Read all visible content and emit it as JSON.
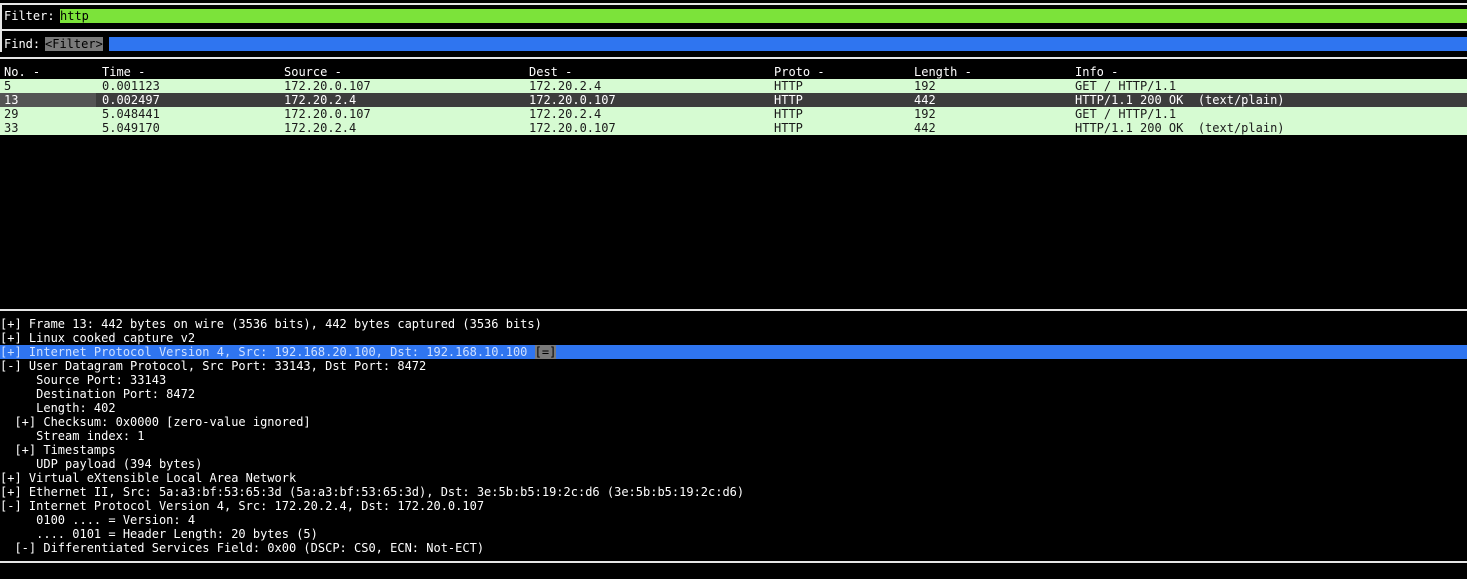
{
  "filter": {
    "label": "Filter:",
    "value": "http"
  },
  "find": {
    "label": "Find:",
    "placeholder": "<Filter>"
  },
  "packet_list": {
    "headers": [
      "No. -",
      "Time -",
      "Source -",
      "Dest -",
      "Proto -",
      "Length -",
      "Info -"
    ],
    "rows": [
      {
        "no": "5",
        "time": "0.001123",
        "src": "172.20.0.107",
        "dst": "172.20.2.4",
        "proto": "HTTP",
        "len": "192",
        "info": "GET / HTTP/1.1",
        "selected": false
      },
      {
        "no": "13",
        "time": "0.002497",
        "src": "172.20.2.4",
        "dst": "172.20.0.107",
        "proto": "HTTP",
        "len": "442",
        "info": "HTTP/1.1 200 OK  (text/plain)",
        "selected": true
      },
      {
        "no": "29",
        "time": "5.048441",
        "src": "172.20.0.107",
        "dst": "172.20.2.4",
        "proto": "HTTP",
        "len": "192",
        "info": "GET / HTTP/1.1",
        "selected": false
      },
      {
        "no": "33",
        "time": "5.049170",
        "src": "172.20.2.4",
        "dst": "172.20.0.107",
        "proto": "HTTP",
        "len": "442",
        "info": "HTTP/1.1 200 OK  (text/plain)",
        "selected": false
      }
    ]
  },
  "details": [
    {
      "text": "[+] Frame 13: 442 bytes on wire (3536 bits), 442 bytes captured (3536 bits)",
      "highlight": false
    },
    {
      "text": "[+] Linux cooked capture v2",
      "highlight": false
    },
    {
      "text": "[+] Internet Protocol Version 4, Src: 192.168.20.100, Dst: 192.168.10.100 ",
      "badge": "[=]",
      "highlight": true
    },
    {
      "text": "[-] User Datagram Protocol, Src Port: 33143, Dst Port: 8472",
      "highlight": false
    },
    {
      "text": "     Source Port: 33143",
      "highlight": false
    },
    {
      "text": "     Destination Port: 8472",
      "highlight": false
    },
    {
      "text": "     Length: 402",
      "highlight": false
    },
    {
      "text": "  [+] Checksum: 0x0000 [zero-value ignored]",
      "highlight": false
    },
    {
      "text": "     Stream index: 1",
      "highlight": false
    },
    {
      "text": "  [+] Timestamps",
      "highlight": false
    },
    {
      "text": "     UDP payload (394 bytes)",
      "highlight": false
    },
    {
      "text": "[+] Virtual eXtensible Local Area Network",
      "highlight": false
    },
    {
      "text": "[+] Ethernet II, Src: 5a:a3:bf:53:65:3d (5a:a3:bf:53:65:3d), Dst: 3e:5b:b5:19:2c:d6 (3e:5b:b5:19:2c:d6)",
      "highlight": false
    },
    {
      "text": "[-] Internet Protocol Version 4, Src: 172.20.2.4, Dst: 172.20.0.107",
      "highlight": false
    },
    {
      "text": "     0100 .... = Version: 4",
      "highlight": false
    },
    {
      "text": "     .... 0101 = Header Length: 20 bytes (5)",
      "highlight": false
    },
    {
      "text": "  [-] Differentiated Services Field: 0x00 (DSCP: CS0, ECN: Not-ECT)",
      "highlight": false
    }
  ],
  "colors": {
    "filter_bg": "#7ce33a",
    "find_bg": "#2f75f0",
    "row_bg": "#d6fbd2",
    "selected_row_bg": "#3c3c3c",
    "detail_highlight_bg": "#2f75f0"
  }
}
